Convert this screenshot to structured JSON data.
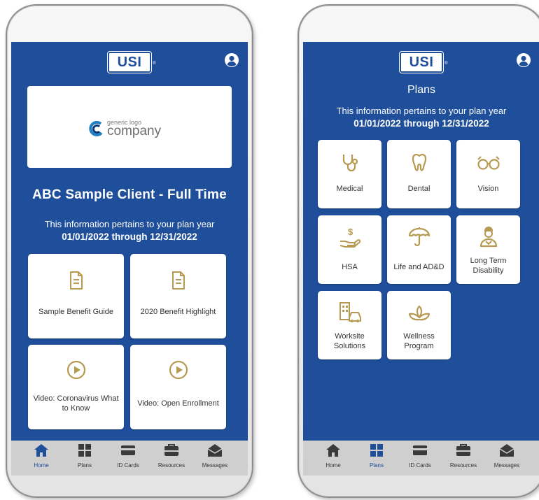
{
  "brand_logo": "USI",
  "colors": {
    "primary": "#1f4e9b",
    "gold": "#b69a52",
    "tabbar": "#cfcfcf"
  },
  "home": {
    "company_logo_small": "generic logo",
    "company_logo_big": "company",
    "client_title": "ABC Sample Client - Full Time",
    "plan_note": "This information pertains to your plan year",
    "plan_dates": "01/01/2022 through 12/31/2022",
    "tiles": [
      {
        "label": "Sample Benefit Guide",
        "icon": "document-icon"
      },
      {
        "label": "2020 Benefit Highlight",
        "icon": "document-icon"
      },
      {
        "label": "Video: Coronavirus  What to Know",
        "icon": "play-icon"
      },
      {
        "label": "Video: Open Enrollment",
        "icon": "play-icon"
      }
    ],
    "active_tab": "Home"
  },
  "plans": {
    "title": "Plans",
    "plan_note": "This information pertains to your plan year",
    "plan_dates": "01/01/2022 through 12/31/2022",
    "tiles": [
      {
        "label": "Medical",
        "icon": "stethoscope-icon"
      },
      {
        "label": "Dental",
        "icon": "tooth-icon"
      },
      {
        "label": "Vision",
        "icon": "glasses-icon"
      },
      {
        "label": "HSA",
        "icon": "hand-dollar-icon"
      },
      {
        "label": "Life and AD&D",
        "icon": "umbrella-icon"
      },
      {
        "label": "Long Term Disability",
        "icon": "person-icon"
      },
      {
        "label": "Worksite Solutions",
        "icon": "building-car-icon"
      },
      {
        "label": "Wellness Program",
        "icon": "lotus-icon"
      }
    ],
    "active_tab": "Plans"
  },
  "tabs": [
    {
      "label": "Home",
      "icon": "home-icon"
    },
    {
      "label": "Plans",
      "icon": "grid-icon"
    },
    {
      "label": "ID Cards",
      "icon": "card-icon"
    },
    {
      "label": "Resources",
      "icon": "toolbox-icon"
    },
    {
      "label": "Messages",
      "icon": "envelope-icon"
    }
  ]
}
